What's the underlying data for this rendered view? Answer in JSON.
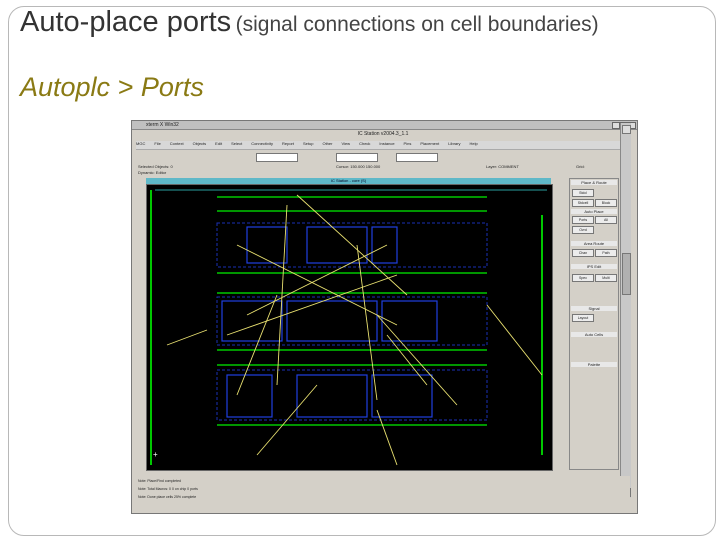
{
  "slide": {
    "title_main": "Auto-place ports",
    "title_paren": "(signal connections on cell boundaries)",
    "subtitle": "Autoplc > Ports"
  },
  "window": {
    "title": "xterm X Win32",
    "app_title": "IC Station v2004.3_1.1"
  },
  "menu": [
    "MGC",
    "File",
    "Context",
    "Objects",
    "Edit",
    "Select",
    "Connectivity",
    "Report",
    "Setup",
    "Other",
    "View",
    "Check",
    "Instance",
    "Pins",
    "Placement",
    "Library",
    "Help"
  ],
  "toolbar": {
    "field1": "",
    "field2": "",
    "field3": ""
  },
  "status": {
    "left1": "Selected Objects: 0",
    "left2": "Dynamic: Editor",
    "mid": "Cursor: 150.000  150.000",
    "right": "Layer: COMMENT",
    "far_right": "Grid:"
  },
  "canvas": {
    "title": "IC Station - core (S)"
  },
  "panel": {
    "header": "Place & Route",
    "sections": [
      "Auto Place",
      "Area Route",
      "IPS Edit",
      "Signal",
      "Auto Cells",
      "Palette"
    ],
    "buttons": [
      "Stdcl",
      "Stdcell",
      "Block",
      "Ports",
      "All",
      "Ovrd",
      "Chan",
      "Path",
      "Spec",
      "Multi",
      "Layout"
    ]
  },
  "log": [
    "Note: Place/Find completed",
    "Note: Total Macros: 0  0 on chip 0 ports",
    "Note: Done place cells 25% complete"
  ],
  "colors": {
    "canvas_bg": "#000000",
    "rail": "#00c800",
    "cell": "#1a2fb5",
    "wire": "#e8e070",
    "title_bar": "#5fb8c8",
    "subtitle": "#8a7a14"
  }
}
